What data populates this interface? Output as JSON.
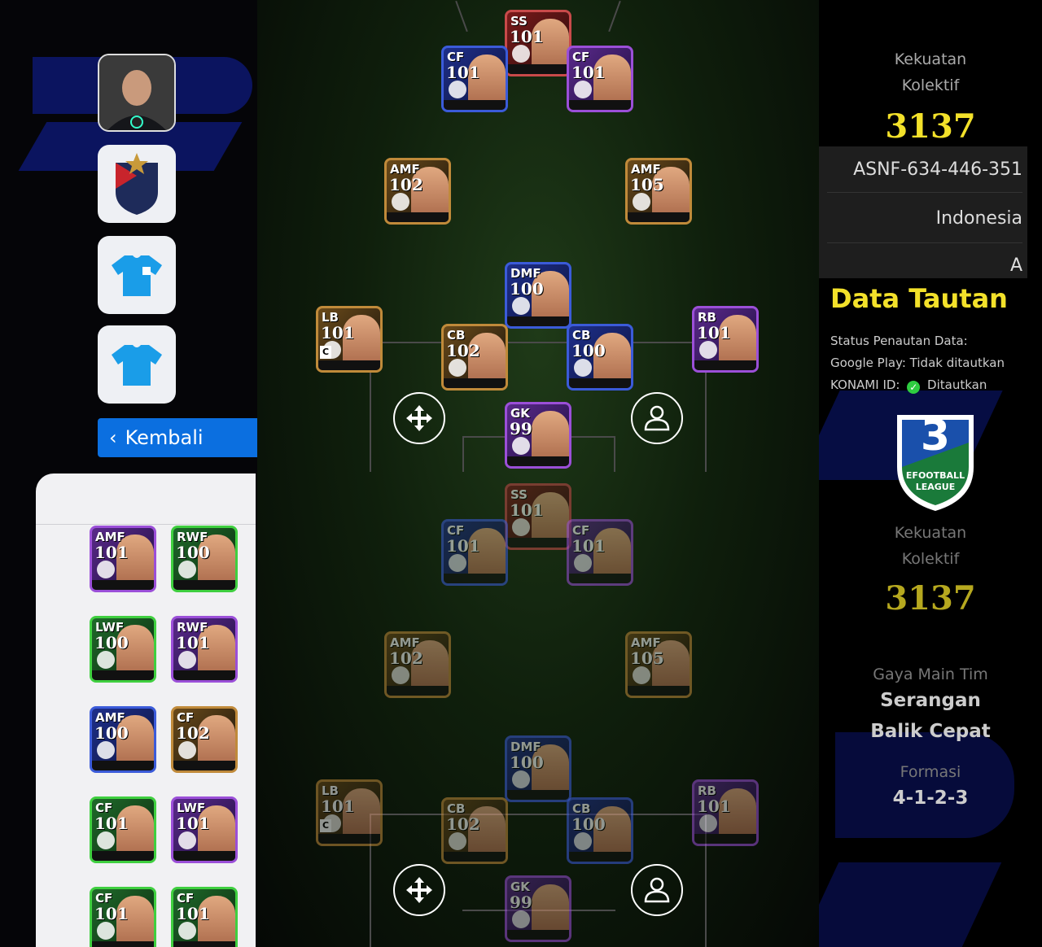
{
  "sidebar": {
    "back_label": "Kembali"
  },
  "formation_top": {
    "players": [
      {
        "id": "ss",
        "pos": "SS",
        "ovr": "101"
      },
      {
        "id": "cf1",
        "pos": "CF",
        "ovr": "101"
      },
      {
        "id": "cf2",
        "pos": "CF",
        "ovr": "101"
      },
      {
        "id": "amf1",
        "pos": "AMF",
        "ovr": "102"
      },
      {
        "id": "amf2",
        "pos": "AMF",
        "ovr": "105"
      },
      {
        "id": "dmf",
        "pos": "DMF",
        "ovr": "100"
      },
      {
        "id": "lb",
        "pos": "LB",
        "ovr": "101"
      },
      {
        "id": "cb1",
        "pos": "CB",
        "ovr": "102"
      },
      {
        "id": "cb2",
        "pos": "CB",
        "ovr": "100"
      },
      {
        "id": "rb",
        "pos": "RB",
        "ovr": "101"
      },
      {
        "id": "gk",
        "pos": "GK",
        "ovr": "99"
      }
    ],
    "captain_mark": "C"
  },
  "formation_bottom": {
    "players": [
      {
        "id": "ss",
        "pos": "SS",
        "ovr": "101"
      },
      {
        "id": "cf1",
        "pos": "CF",
        "ovr": "101"
      },
      {
        "id": "cf2",
        "pos": "CF",
        "ovr": "101"
      },
      {
        "id": "amf1",
        "pos": "AMF",
        "ovr": "102"
      },
      {
        "id": "amf2",
        "pos": "AMF",
        "ovr": "105"
      },
      {
        "id": "dmf",
        "pos": "DMF",
        "ovr": "100"
      },
      {
        "id": "lb",
        "pos": "LB",
        "ovr": "101"
      },
      {
        "id": "cb1",
        "pos": "CB",
        "ovr": "102"
      },
      {
        "id": "cb2",
        "pos": "CB",
        "ovr": "100"
      },
      {
        "id": "rb",
        "pos": "RB",
        "ovr": "101"
      },
      {
        "id": "gk",
        "pos": "GK",
        "ovr": "99"
      }
    ],
    "captain_mark": "C"
  },
  "bench": [
    {
      "pos": "AMF",
      "ovr": "101"
    },
    {
      "pos": "RWF",
      "ovr": "100"
    },
    {
      "pos": "LWF",
      "ovr": "100"
    },
    {
      "pos": "RWF",
      "ovr": "101"
    },
    {
      "pos": "AMF",
      "ovr": "100"
    },
    {
      "pos": "CF",
      "ovr": "102"
    },
    {
      "pos": "CF",
      "ovr": "101"
    },
    {
      "pos": "LWF",
      "ovr": "101"
    },
    {
      "pos": "CF",
      "ovr": "101"
    },
    {
      "pos": "CF",
      "ovr": "101"
    }
  ],
  "right_panel": {
    "strength_label_1": "Kekuatan",
    "strength_label_2": "Kolektif",
    "strength_value": "3137",
    "user_id": "ASNF-634-446-351",
    "country": "Indonesia",
    "rank": "A",
    "data_link_title": "Data Tautan",
    "status_label": "Status Penautan Data:",
    "google_play": "Google Play: Tidak ditautkan",
    "konami_prefix": "KONAMI ID:",
    "konami_status": "Ditautkan",
    "league_number": "3",
    "league_name_1": "EFOOTBALL",
    "league_name_2": "LEAGUE",
    "strength2_label_1": "Kekuatan",
    "strength2_label_2": "Kolektif",
    "strength2_value": "3137",
    "playstyle_label": "Gaya Main Tim",
    "playstyle_1": "Serangan",
    "playstyle_2": "Balik Cepat",
    "formation_label": "Formasi",
    "formation_value": "4-1-2-3"
  },
  "colors": {
    "accent_yellow": "#f3e12a",
    "back_button_blue": "#0b6fe0"
  }
}
